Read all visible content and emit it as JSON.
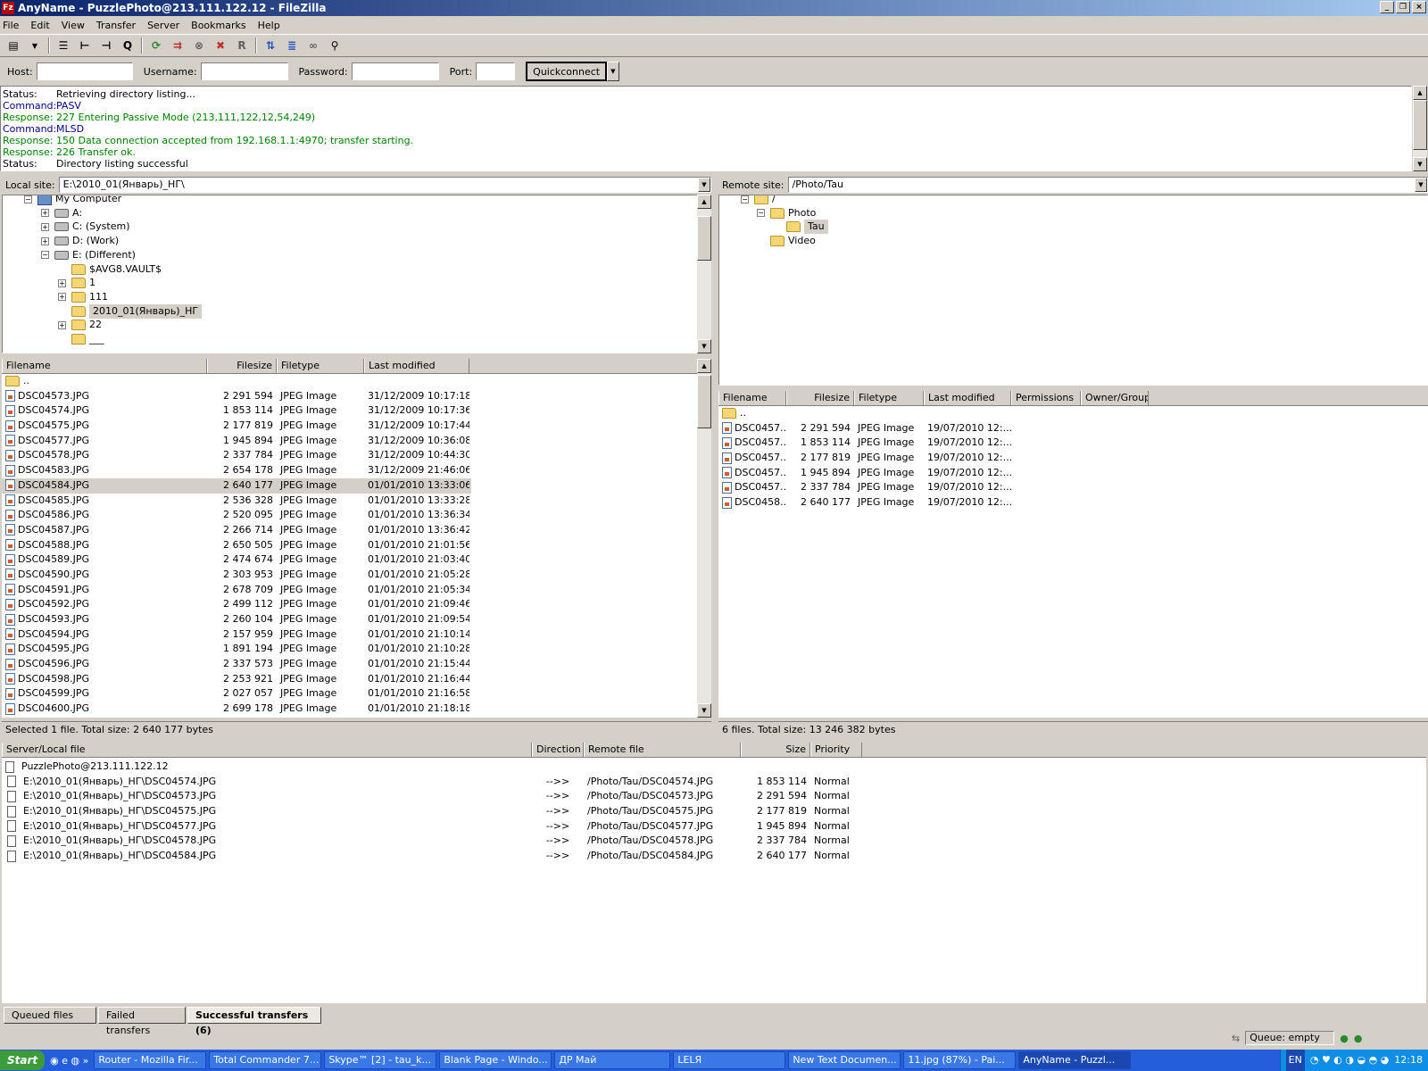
{
  "title": "AnyName - PuzzlePhoto@213.111.122.12 - FileZilla",
  "menu": [
    "File",
    "Edit",
    "View",
    "Transfer",
    "Server",
    "Bookmarks",
    "Help"
  ],
  "quickconnect": {
    "host_label": "Host:",
    "user_label": "Username:",
    "pass_label": "Password:",
    "port_label": "Port:",
    "button": "Quickconnect"
  },
  "log": [
    {
      "k": "Status:",
      "v": "Retrieving directory listing...",
      "c": "#000"
    },
    {
      "k": "Command:",
      "v": "PASV",
      "c": "#00008b"
    },
    {
      "k": "Response:",
      "v": "227 Entering Passive Mode (213,111,122,12,54,249)",
      "c": "#008000"
    },
    {
      "k": "Command:",
      "v": "MLSD",
      "c": "#00008b"
    },
    {
      "k": "Response:",
      "v": "150 Data connection accepted from 192.168.1.1:4970; transfer starting.",
      "c": "#008000"
    },
    {
      "k": "Response:",
      "v": "226 Transfer ok.",
      "c": "#008000"
    },
    {
      "k": "Status:",
      "v": "Directory listing successful",
      "c": "#000"
    }
  ],
  "local": {
    "label": "Local site:",
    "path": "E:\\2010_01(Январь)_НГ\\",
    "status": "Selected 1 file. Total size: 2 640 177 bytes",
    "tree": [
      {
        "label": "My Computer",
        "lvl": 0,
        "exp": "−",
        "type": "comp"
      },
      {
        "label": "A:",
        "lvl": 1,
        "exp": "+",
        "type": "drive"
      },
      {
        "label": "C: (System)",
        "lvl": 1,
        "exp": "+",
        "type": "drive"
      },
      {
        "label": "D: (Work)",
        "lvl": 1,
        "exp": "+",
        "type": "drive"
      },
      {
        "label": "E: (Different)",
        "lvl": 1,
        "exp": "−",
        "type": "drive"
      },
      {
        "label": "$AVG8.VAULT$",
        "lvl": 2,
        "exp": "",
        "type": "folder"
      },
      {
        "label": "1",
        "lvl": 2,
        "exp": "+",
        "type": "folder"
      },
      {
        "label": "111",
        "lvl": 2,
        "exp": "+",
        "type": "folder"
      },
      {
        "label": "2010_01(Январь)_НГ",
        "lvl": 2,
        "exp": "",
        "type": "folder",
        "sel": true
      },
      {
        "label": "22",
        "lvl": 2,
        "exp": "+",
        "type": "folder"
      },
      {
        "label": "___",
        "lvl": 2,
        "exp": "",
        "type": "folder"
      }
    ],
    "headers": [
      "Filename",
      "Filesize",
      "Filetype",
      "Last modified"
    ],
    "files": [
      [
        "..",
        "",
        "",
        ""
      ],
      [
        "DSC04573.JPG",
        "2 291 594",
        "JPEG Image",
        "31/12/2009 10:17:18"
      ],
      [
        "DSC04574.JPG",
        "1 853 114",
        "JPEG Image",
        "31/12/2009 10:17:36"
      ],
      [
        "DSC04575.JPG",
        "2 177 819",
        "JPEG Image",
        "31/12/2009 10:17:44"
      ],
      [
        "DSC04577.JPG",
        "1 945 894",
        "JPEG Image",
        "31/12/2009 10:36:08"
      ],
      [
        "DSC04578.JPG",
        "2 337 784",
        "JPEG Image",
        "31/12/2009 10:44:30"
      ],
      [
        "DSC04583.JPG",
        "2 654 178",
        "JPEG Image",
        "31/12/2009 21:46:06"
      ],
      [
        "DSC04584.JPG",
        "2 640 177",
        "JPEG Image",
        "01/01/2010 13:33:06"
      ],
      [
        "DSC04585.JPG",
        "2 536 328",
        "JPEG Image",
        "01/01/2010 13:33:28"
      ],
      [
        "DSC04586.JPG",
        "2 520 095",
        "JPEG Image",
        "01/01/2010 13:36:34"
      ],
      [
        "DSC04587.JPG",
        "2 266 714",
        "JPEG Image",
        "01/01/2010 13:36:42"
      ],
      [
        "DSC04588.JPG",
        "2 650 505",
        "JPEG Image",
        "01/01/2010 21:01:56"
      ],
      [
        "DSC04589.JPG",
        "2 474 674",
        "JPEG Image",
        "01/01/2010 21:03:40"
      ],
      [
        "DSC04590.JPG",
        "2 303 953",
        "JPEG Image",
        "01/01/2010 21:05:28"
      ],
      [
        "DSC04591.JPG",
        "2 678 709",
        "JPEG Image",
        "01/01/2010 21:05:34"
      ],
      [
        "DSC04592.JPG",
        "2 499 112",
        "JPEG Image",
        "01/01/2010 21:09:46"
      ],
      [
        "DSC04593.JPG",
        "2 260 104",
        "JPEG Image",
        "01/01/2010 21:09:54"
      ],
      [
        "DSC04594.JPG",
        "2 157 959",
        "JPEG Image",
        "01/01/2010 21:10:14"
      ],
      [
        "DSC04595.JPG",
        "1 891 194",
        "JPEG Image",
        "01/01/2010 21:10:28"
      ],
      [
        "DSC04596.JPG",
        "2 337 573",
        "JPEG Image",
        "01/01/2010 21:15:44"
      ],
      [
        "DSC04598.JPG",
        "2 253 921",
        "JPEG Image",
        "01/01/2010 21:16:44"
      ],
      [
        "DSC04599.JPG",
        "2 027 057",
        "JPEG Image",
        "01/01/2010 21:16:58"
      ],
      [
        "DSC04600.JPG",
        "2 699 178",
        "JPEG Image",
        "01/01/2010 21:18:18"
      ]
    ],
    "selected_index": 7
  },
  "remote": {
    "label": "Remote site:",
    "path": "/Photo/Tau",
    "status": "6 files. Total size: 13 246 382 bytes",
    "tree": [
      {
        "label": "/",
        "lvl": 0,
        "exp": "−",
        "type": "folder"
      },
      {
        "label": "Photo",
        "lvl": 1,
        "exp": "−",
        "type": "folder"
      },
      {
        "label": "Tau",
        "lvl": 2,
        "exp": "",
        "type": "folder",
        "sel": true
      },
      {
        "label": "Video",
        "lvl": 1,
        "exp": "",
        "type": "folder"
      }
    ],
    "headers": [
      "Filename",
      "Filesize",
      "Filetype",
      "Last modified",
      "Permissions",
      "Owner/Group"
    ],
    "files": [
      [
        "..",
        "",
        "",
        "",
        "",
        ""
      ],
      [
        "DSC0457...",
        "2 291 594",
        "JPEG Image",
        "19/07/2010 12:...",
        "",
        ""
      ],
      [
        "DSC0457...",
        "1 853 114",
        "JPEG Image",
        "19/07/2010 12:...",
        "",
        ""
      ],
      [
        "DSC0457...",
        "2 177 819",
        "JPEG Image",
        "19/07/2010 12:...",
        "",
        ""
      ],
      [
        "DSC0457...",
        "1 945 894",
        "JPEG Image",
        "19/07/2010 12:...",
        "",
        ""
      ],
      [
        "DSC0457...",
        "2 337 784",
        "JPEG Image",
        "19/07/2010 12:...",
        "",
        ""
      ],
      [
        "DSC0458...",
        "2 640 177",
        "JPEG Image",
        "19/07/2010 12:...",
        "",
        ""
      ]
    ]
  },
  "queue": {
    "headers": [
      "Server/Local file",
      "Direction",
      "Remote file",
      "Size",
      "Priority"
    ],
    "server": "PuzzlePhoto@213.111.122.12",
    "items": [
      [
        "E:\\2010_01(Январь)_НГ\\DSC04574.JPG",
        "-->>",
        "/Photo/Tau/DSC04574.JPG",
        "1 853 114",
        "Normal"
      ],
      [
        "E:\\2010_01(Январь)_НГ\\DSC04573.JPG",
        "-->>",
        "/Photo/Tau/DSC04573.JPG",
        "2 291 594",
        "Normal"
      ],
      [
        "E:\\2010_01(Январь)_НГ\\DSC04575.JPG",
        "-->>",
        "/Photo/Tau/DSC04575.JPG",
        "2 177 819",
        "Normal"
      ],
      [
        "E:\\2010_01(Январь)_НГ\\DSC04577.JPG",
        "-->>",
        "/Photo/Tau/DSC04577.JPG",
        "1 945 894",
        "Normal"
      ],
      [
        "E:\\2010_01(Январь)_НГ\\DSC04578.JPG",
        "-->>",
        "/Photo/Tau/DSC04578.JPG",
        "2 337 784",
        "Normal"
      ],
      [
        "E:\\2010_01(Январь)_НГ\\DSC04584.JPG",
        "-->>",
        "/Photo/Tau/DSC04584.JPG",
        "2 640 177",
        "Normal"
      ]
    ],
    "tabs": [
      "Queued files",
      "Failed transfers",
      "Successful transfers (6)"
    ],
    "active_tab": 2,
    "status": "Queue: empty"
  },
  "taskbar": {
    "start": "Start",
    "items": [
      "Router - Mozilla Fir...",
      "Total Commander 7...",
      "Skype™ [2] - tau_k...",
      "Blank Page - Windo...",
      "ДР Май",
      "LELЯ",
      "New Text Documen...",
      "11.jpg (87%) - Pai...",
      "AnyName - Puzzl..."
    ],
    "active": 8,
    "lang": "EN",
    "clock": "12:18"
  }
}
